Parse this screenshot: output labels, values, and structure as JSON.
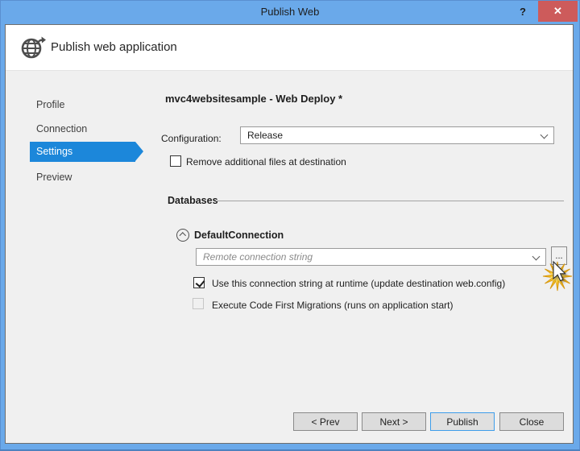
{
  "window": {
    "title": "Publish Web",
    "help_glyph": "?",
    "close_glyph": "✕"
  },
  "header": {
    "title": "Publish web application"
  },
  "sidebar": {
    "items": [
      {
        "label": "Profile",
        "selected": false
      },
      {
        "label": "Connection",
        "selected": false
      },
      {
        "label": "Settings",
        "selected": true
      },
      {
        "label": "Preview",
        "selected": false
      }
    ]
  },
  "main": {
    "profile_heading": "mvc4websitesample - Web Deploy *",
    "configuration_label": "Configuration:",
    "configuration_value": "Release",
    "remove_files_label": "Remove additional files at destination",
    "remove_files_checked": false,
    "databases_heading": "Databases",
    "connection_name": "DefaultConnection",
    "connection_string_value": "",
    "connection_string_placeholder": "Remote connection string",
    "browse_label": "...",
    "runtime_label": "Use this connection string at runtime (update destination web.config)",
    "runtime_checked": true,
    "migrations_label": "Execute Code First Migrations (runs on application start)",
    "migrations_checked": false,
    "migrations_disabled": true
  },
  "footer": {
    "prev": "< Prev",
    "next": "Next >",
    "publish": "Publish",
    "close": "Close"
  },
  "colors": {
    "titlebar_blue": "#6aa9ea",
    "selection_blue": "#1c87da",
    "close_red": "#cd5b5b",
    "publish_border_blue": "#3e9dea",
    "starburst_yellow": "#f8c426",
    "body_gray": "#f0f0f0",
    "header_white": "#ffffff"
  },
  "icons": {
    "globe-publish-icon": "globe with up-right arrow",
    "help-icon": "?",
    "close-icon": "✕",
    "collapse-up-icon": "circled chevron up",
    "dropdown-chevron-icon": "chevron down",
    "starburst-highlight-icon": "yellow click starburst",
    "mouse-cursor-icon": "arrow pointer"
  }
}
